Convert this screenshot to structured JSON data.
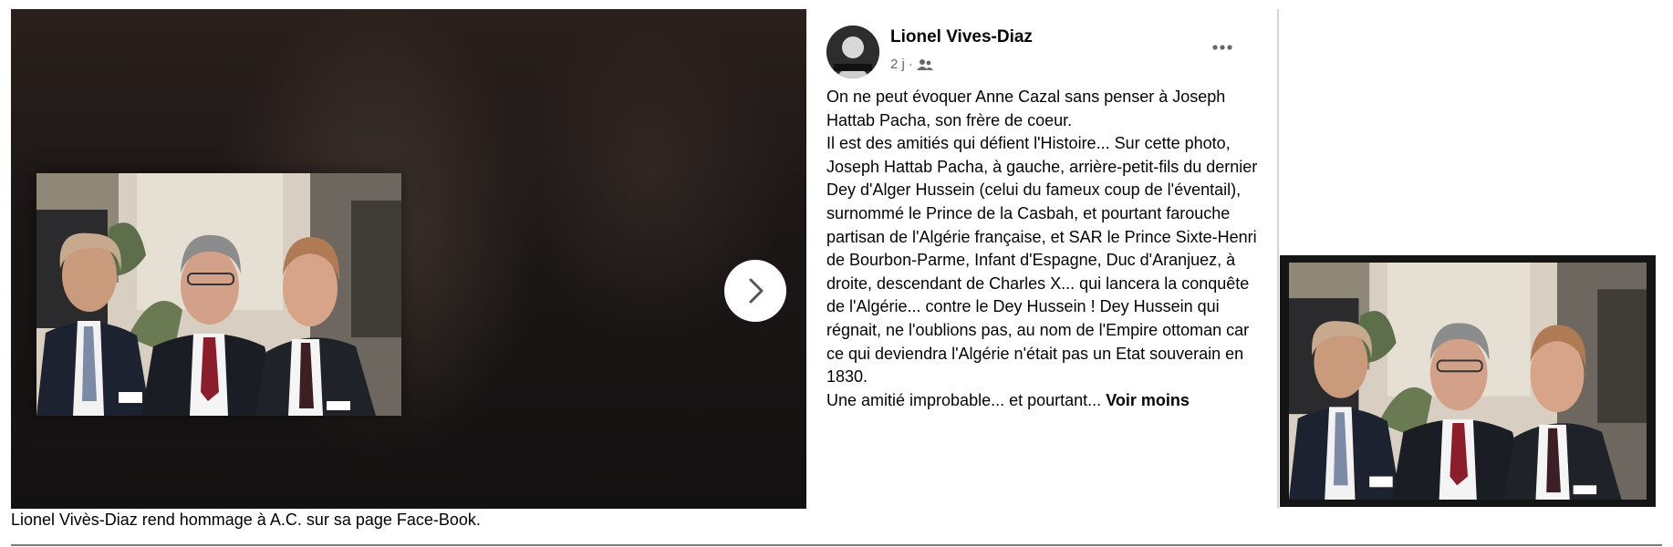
{
  "post": {
    "author": "Lionel Vives-Diaz",
    "time": "2 j",
    "audience_icon": "friends-icon",
    "paragraphs": [
      "On ne peut évoquer Anne Cazal sans penser à Joseph Hattab Pacha, son frère de coeur.",
      "Il est des amitiés qui défient l'Histoire... Sur cette photo, Joseph Hattab Pacha, à gauche, arrière-petit-fils du dernier Dey d'Alger Hussein (celui du fameux coup de l'éventail), surnommé le Prince de la Casbah, et pourtant farouche partisan de l'Algérie française, et SAR le Prince Sixte-Henri de Bourbon-Parme, Infant d'Espagne, Duc d'Aranjuez, à droite, descendant de Charles X... qui lancera la conquête de l'Algérie... contre le Dey Hussein ! Dey Hussein qui régnait, ne l'oublions pas, au nom de l'Empire ottoman car ce qui deviendra l'Algérie n'était pas un Etat souverain en 1830.",
      "Une amitié improbable... et pourtant..."
    ],
    "see_less_label": "Voir moins"
  },
  "viewer": {
    "next_icon": "chevron-right-icon"
  },
  "caption": "Lionel Vivès-Diaz rend hommage à A.C. sur sa page Face-Book.",
  "colors": {
    "meta_text": "#65676b",
    "viewer_bg": "#1c1716",
    "text": "#050505"
  }
}
